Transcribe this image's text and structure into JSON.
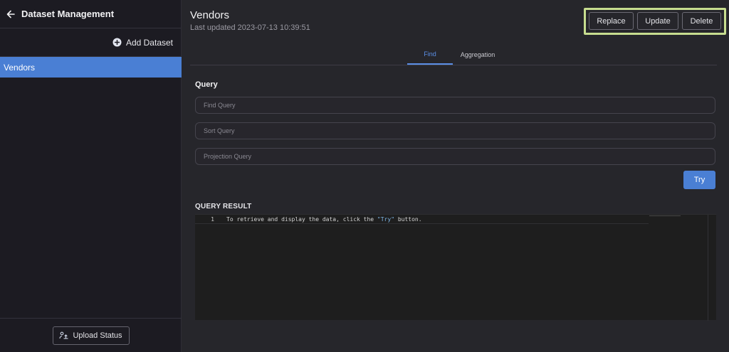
{
  "sidebar": {
    "title": "Dataset Management",
    "add_label": "Add Dataset",
    "items": [
      {
        "label": "Vendors",
        "selected": true
      }
    ],
    "upload_label": "Upload Status"
  },
  "header": {
    "title": "Vendors",
    "updated_prefix": "Last updated",
    "updated_value": "2023-07-13 10:39:51"
  },
  "actions": {
    "replace": "Replace",
    "update": "Update",
    "delete": "Delete"
  },
  "tabs": [
    {
      "label": "Find",
      "active": true
    },
    {
      "label": "Aggregation",
      "active": false
    }
  ],
  "query": {
    "heading": "Query",
    "find_placeholder": "Find Query",
    "sort_placeholder": "Sort Query",
    "projection_placeholder": "Projection Query",
    "try_label": "Try"
  },
  "result": {
    "heading": "QUERY RESULT",
    "line_number": "1",
    "code_before": "To retrieve and display the data, click the ",
    "code_string": "\"Try\"",
    "code_after": " button."
  },
  "colors": {
    "accent": "#4a7fd4",
    "highlight": "#c7dd8f",
    "sidebar_bg": "#1c1b22",
    "main_bg": "#26262b"
  }
}
